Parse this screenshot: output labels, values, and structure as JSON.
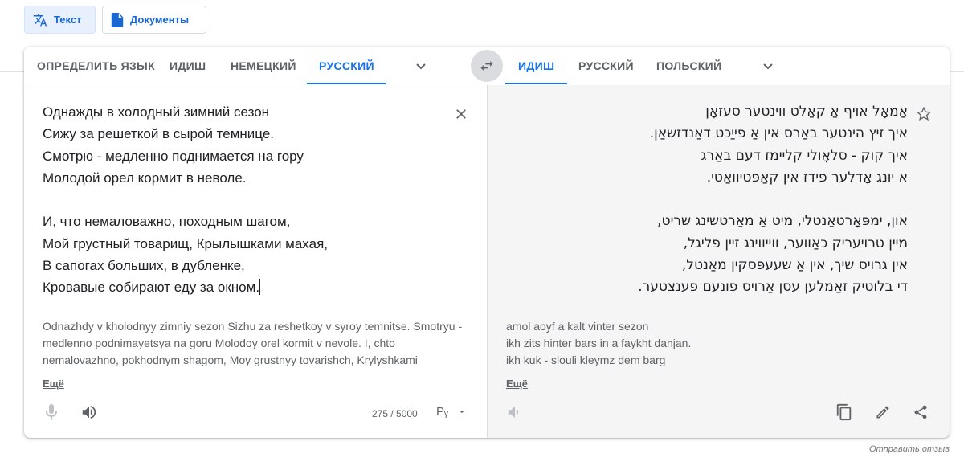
{
  "modes": {
    "text_label": "Текст",
    "docs_label": "Документы"
  },
  "source_tabs": [
    "ОПРЕДЕЛИТЬ ЯЗЫК",
    "ИДИШ",
    "НЕМЕЦКИЙ",
    "РУССКИЙ"
  ],
  "target_tabs": [
    "ИДИШ",
    "РУССКИЙ",
    "ПОЛЬСКИЙ"
  ],
  "source_selected": "РУССКИЙ",
  "target_selected": "ИДИШ",
  "source": {
    "text": "Однажды в холодный зимний сезон\nСижу за решеткой в сырой темнице.\nСмотрю - медленно поднимается на гору\nМолодой орел кормит в неволе.\n\nИ, что немаловажно, походным шагом,\nМой грустный товарищ, Крылышками махая,\nВ сапогах больших, в дубленке,\nКровавые собирают еду за окном.",
    "transliteration": "Odnazhdy v kholodnyy zimniy sezon Sizhu za reshetkoy v syroy temnitse. Smotryu - medlenno podnimayetsya na goru Molodoy orel kormit v nevole. I, chto nemalovazhno, pokhodnym shagom, Moy grustnyy tovarishch, Krylyshkami",
    "more_label": "Ещё",
    "char_count": "275 / 5000",
    "keyboard_label": "Рᵧ"
  },
  "target": {
    "text": "אַמאָל אויף אַ קאַלט ווינטער סעזאָן\nאיך זיץ הינטער באַרס אין אַ פייַכט דאַנדזשאַן.\nאיך קוק - סלאָולי קליימז דעם באַרג\nא יונג אָדלער פידז אין קאַפּטיוואַטי.\n\nאון, ימפּאָרטאַנטלי, מיט אַ מאַרטשינג שריט,\nמיין טרויעריק כאַווער, ווייווינג זיין פליגל,\nאין גרויס שיך, אין אַ שעעפּסקין מאַנטל,\nדי בלוטיק זאַמלען עסן אַרויס פונעם פענצטער.",
    "transliteration": "amol aoyf a kalt vinter sezon\nikh zits hinter bars in a faykht danjan.\nikh kuk - slouli kleymz dem barg",
    "more_label": "Ещё"
  },
  "footer": {
    "feedback_label": "Отправить отзыв"
  },
  "colors": {
    "accent": "#1a73e8",
    "tab_text": "#5f6368",
    "target_pane_bg": "#f5f5f5"
  },
  "icons": [
    "translate-icon",
    "document-icon",
    "chevron-down-icon",
    "swap-icon",
    "close-icon",
    "microphone-icon",
    "speaker-icon",
    "star-icon",
    "copy-icon",
    "edit-icon",
    "share-icon"
  ]
}
